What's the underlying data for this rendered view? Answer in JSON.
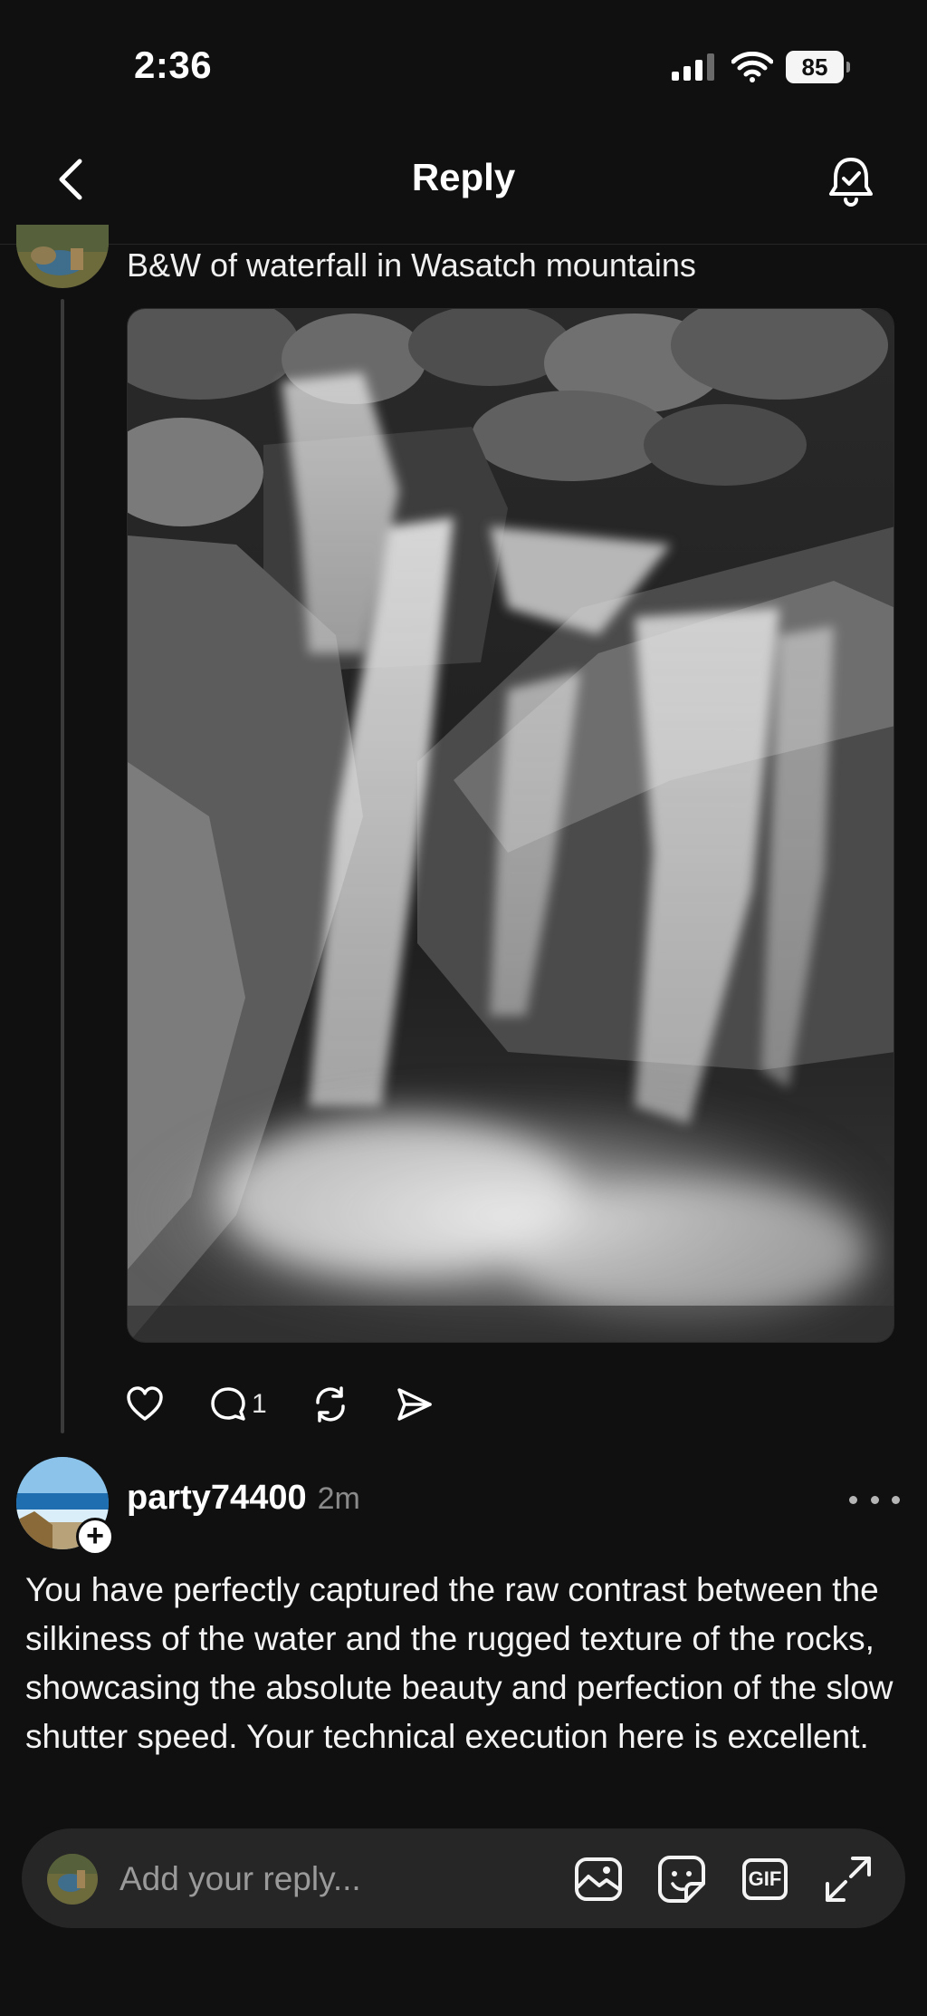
{
  "status_bar": {
    "time": "2:36",
    "battery": "85"
  },
  "header": {
    "title": "Reply"
  },
  "original_post": {
    "caption": "B&W of waterfall in Wasatch mountains",
    "actions": {
      "reply_count": "1"
    }
  },
  "reply": {
    "username": "party74400",
    "time": "2m",
    "follow_symbol": "+",
    "body": "You have perfectly captured the raw contrast between the silkiness of the water and the rugged texture of the rocks, showcasing the absolute beauty and perfection of the slow shutter speed. Your technical execution here is excellent."
  },
  "composer": {
    "placeholder": "Add your reply...",
    "gif_label": "GIF"
  },
  "icons": {
    "back": "chevron-left-icon",
    "notify": "bell-check-icon",
    "like": "heart-icon",
    "comment": "comment-bubble-icon",
    "repost": "repost-icon",
    "share": "send-icon",
    "more": "more-dots-icon",
    "image": "image-icon",
    "sticker": "sticker-icon",
    "gif": "gif-icon",
    "expand": "expand-icon"
  },
  "colors": {
    "background": "#101010",
    "text": "#f3f3f3",
    "muted": "#8a8a8a",
    "composer": "#262626"
  }
}
